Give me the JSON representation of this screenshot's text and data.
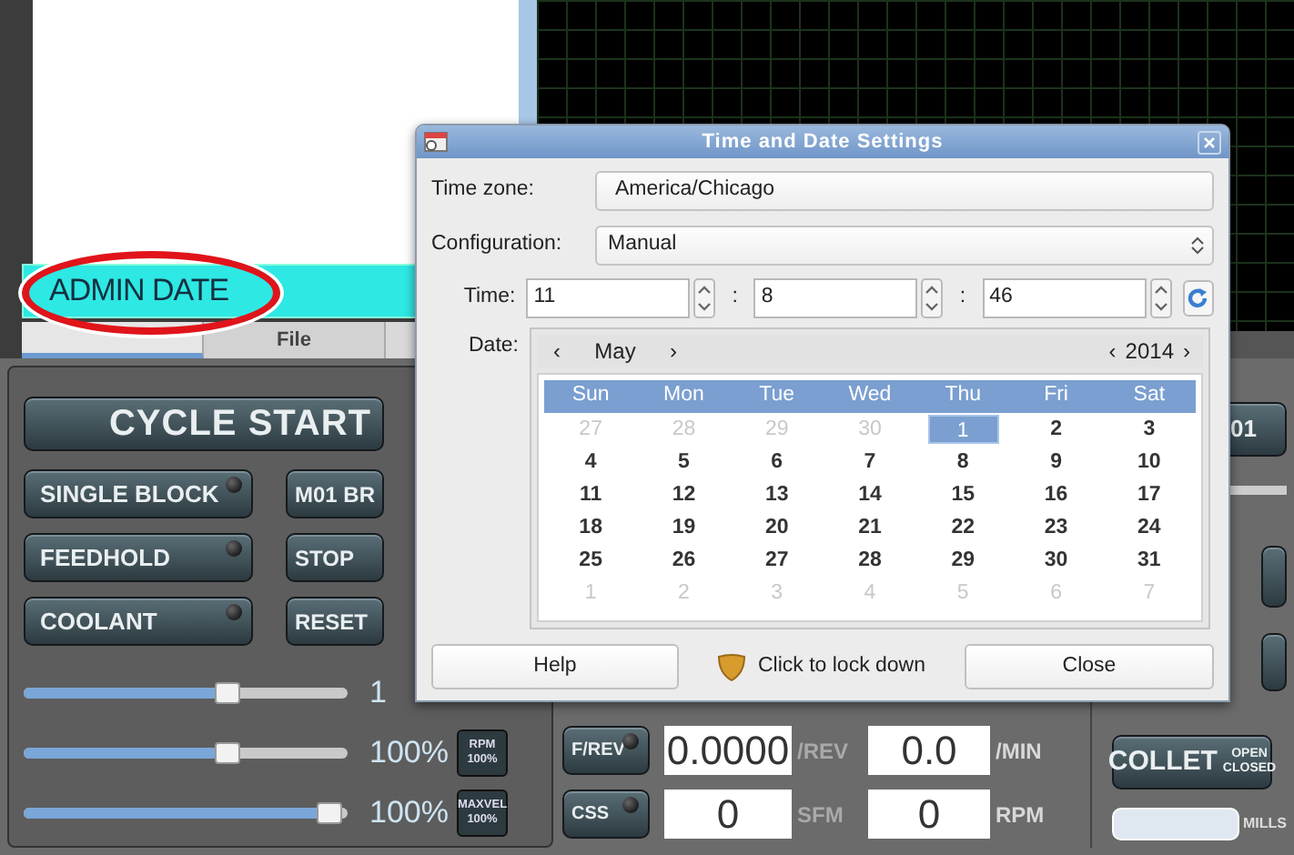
{
  "command_field": {
    "value": "ADMIN DATE"
  },
  "tabs": [
    {
      "selected": true
    },
    {
      "label": "File",
      "selected": false
    }
  ],
  "cycle_start": "CYCLE START",
  "buttons": [
    {
      "label": "SINGLE BLOCK",
      "led": true
    },
    {
      "label": "M01 BR",
      "led": false
    },
    {
      "label": "FEEDHOLD",
      "led": true
    },
    {
      "label": "STOP",
      "led": false
    },
    {
      "label": "COOLANT",
      "led": true
    },
    {
      "label": "RESET",
      "led": false
    }
  ],
  "overrides": [
    {
      "level": 0.66,
      "reading": "1"
    },
    {
      "level": 0.66,
      "reading": "100%",
      "badge": [
        "RPM",
        "100%"
      ]
    },
    {
      "level": 0.97,
      "reading": "100%",
      "badge": [
        "MAXVEL",
        "100%"
      ]
    }
  ],
  "feed_rows": [
    {
      "button": "F/REV",
      "led": true,
      "value_1": "0.0000",
      "unit_1": "/REV",
      "value_2": "0.0",
      "unit_2": "/MIN"
    },
    {
      "button": "CSS",
      "led": true,
      "value_1": "0",
      "unit_1": "SFM",
      "value_2": "0",
      "unit_2": "RPM"
    }
  ],
  "side_button": "01",
  "collet": {
    "label": "COLLET",
    "states": [
      "OPEN",
      "CLOSED"
    ]
  },
  "logo_caption": "MILLS",
  "dialog": {
    "title": "Time and Date Settings",
    "time_zone": {
      "label": "Time zone:",
      "value": "America/Chicago"
    },
    "configuration": {
      "label": "Configuration:",
      "value": "Manual"
    },
    "time": {
      "label": "Time:",
      "hours": "11",
      "minutes": "8",
      "seconds": "46",
      "separator": ":"
    },
    "date": {
      "label": "Date:",
      "month": "May",
      "year": "2014",
      "prev": "‹",
      "next": "›",
      "weekdays": [
        "Sun",
        "Mon",
        "Tue",
        "Wed",
        "Thu",
        "Fri",
        "Sat"
      ],
      "weeks": [
        [
          {
            "label": "27",
            "muted": true,
            "selected": false
          },
          {
            "label": "28",
            "muted": true,
            "selected": false
          },
          {
            "label": "29",
            "muted": true,
            "selected": false
          },
          {
            "label": "30",
            "muted": true,
            "selected": false
          },
          {
            "label": "1",
            "muted": false,
            "selected": true
          },
          {
            "label": "2",
            "muted": false,
            "selected": false
          },
          {
            "label": "3",
            "muted": false,
            "selected": false
          }
        ],
        [
          {
            "label": "4",
            "muted": false,
            "selected": false
          },
          {
            "label": "5",
            "muted": false,
            "selected": false
          },
          {
            "label": "6",
            "muted": false,
            "selected": false
          },
          {
            "label": "7",
            "muted": false,
            "selected": false
          },
          {
            "label": "8",
            "muted": false,
            "selected": false
          },
          {
            "label": "9",
            "muted": false,
            "selected": false
          },
          {
            "label": "10",
            "muted": false,
            "selected": false
          }
        ],
        [
          {
            "label": "11",
            "muted": false,
            "selected": false
          },
          {
            "label": "12",
            "muted": false,
            "selected": false
          },
          {
            "label": "13",
            "muted": false,
            "selected": false
          },
          {
            "label": "14",
            "muted": false,
            "selected": false
          },
          {
            "label": "15",
            "muted": false,
            "selected": false
          },
          {
            "label": "16",
            "muted": false,
            "selected": false
          },
          {
            "label": "17",
            "muted": false,
            "selected": false
          }
        ],
        [
          {
            "label": "18",
            "muted": false,
            "selected": false
          },
          {
            "label": "19",
            "muted": false,
            "selected": false
          },
          {
            "label": "20",
            "muted": false,
            "selected": false
          },
          {
            "label": "21",
            "muted": false,
            "selected": false
          },
          {
            "label": "22",
            "muted": false,
            "selected": false
          },
          {
            "label": "23",
            "muted": false,
            "selected": false
          },
          {
            "label": "24",
            "muted": false,
            "selected": false
          }
        ],
        [
          {
            "label": "25",
            "muted": false,
            "selected": false
          },
          {
            "label": "26",
            "muted": false,
            "selected": false
          },
          {
            "label": "27",
            "muted": false,
            "selected": false
          },
          {
            "label": "28",
            "muted": false,
            "selected": false
          },
          {
            "label": "29",
            "muted": false,
            "selected": false
          },
          {
            "label": "30",
            "muted": false,
            "selected": false
          },
          {
            "label": "31",
            "muted": false,
            "selected": false
          }
        ],
        [
          {
            "label": "1",
            "muted": true,
            "selected": false
          },
          {
            "label": "2",
            "muted": true,
            "selected": false
          },
          {
            "label": "3",
            "muted": true,
            "selected": false
          },
          {
            "label": "4",
            "muted": true,
            "selected": false
          },
          {
            "label": "5",
            "muted": true,
            "selected": false
          },
          {
            "label": "6",
            "muted": true,
            "selected": false
          },
          {
            "label": "7",
            "muted": true,
            "selected": false
          }
        ]
      ]
    },
    "help": "Help",
    "lock_text": "Click to lock down",
    "close": "Close"
  }
}
